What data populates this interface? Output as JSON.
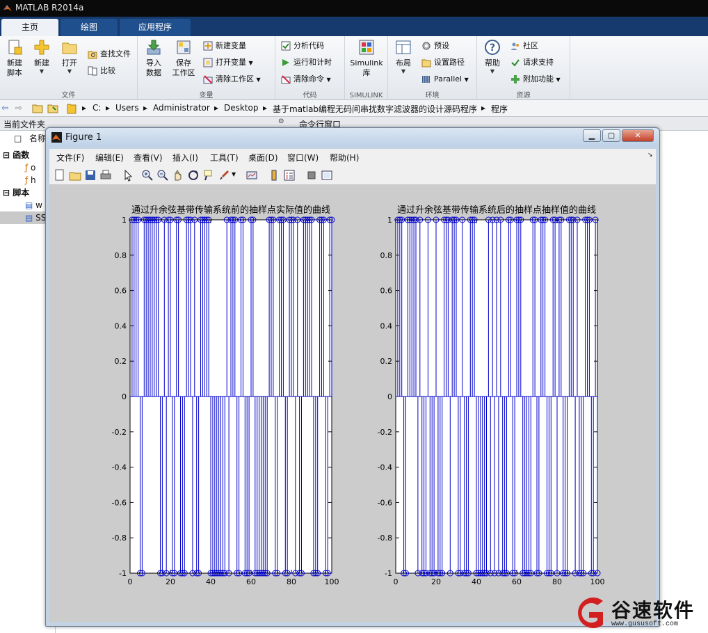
{
  "app": {
    "title": "MATLAB R2014a"
  },
  "tabs": [
    {
      "label": "主页",
      "active": true
    },
    {
      "label": "绘图",
      "active": false
    },
    {
      "label": "应用程序",
      "active": false
    }
  ],
  "ribbon": {
    "file_group": {
      "label": "文件",
      "new_script": "新建\n脚本",
      "new": "新建",
      "open": "打开",
      "find_files": "查找文件",
      "compare": "比较"
    },
    "variable_group": {
      "label": "变量",
      "import_data": "导入\n数据",
      "save_workspace": "保存\n工作区",
      "new_variable": "新建变量",
      "open_variable": "打开变量",
      "clear_workspace": "清除工作区"
    },
    "code_group": {
      "label": "代码",
      "analyze_code": "分析代码",
      "run_and_time": "运行和计时",
      "clear_commands": "清除命令"
    },
    "simulink_group": {
      "label": "SIMULINK",
      "simulink_library": "Simulink\n库"
    },
    "environment_group": {
      "label": "环境",
      "layout": "布局",
      "preferences": "预设",
      "set_path": "设置路径",
      "parallel": "Parallel"
    },
    "resources_group": {
      "label": "资源",
      "help": "帮助",
      "community": "社区",
      "request_support": "请求支持",
      "add_ons": "附加功能"
    }
  },
  "address_bar": {
    "path": [
      "C:",
      "Users",
      "Administrator",
      "Desktop",
      "基于matlab编程无码间串扰数字滤波器的设计源码程序",
      "程序"
    ]
  },
  "panels": {
    "current_folder": "当前文件夹",
    "command_window": "命令行窗口",
    "name_col": "名称",
    "sections": [
      {
        "label": "函数",
        "items": [
          "o",
          "h"
        ]
      },
      {
        "label": "脚本",
        "items": [
          "w",
          "SS"
        ]
      }
    ]
  },
  "figure": {
    "title": "Figure 1",
    "menu": [
      "文件(F)",
      "编辑(E)",
      "查看(V)",
      "插入(I)",
      "工具(T)",
      "桌面(D)",
      "窗口(W)",
      "帮助(H)"
    ]
  },
  "chart_data": [
    {
      "type": "stem",
      "title": "通过升余弦基带传输系统前的抽样点实际值的曲线",
      "xlim": [
        0,
        100
      ],
      "ylim": [
        -1,
        1
      ],
      "xticks": [
        "0",
        "20",
        "40",
        "60",
        "80",
        "100"
      ],
      "yticks": [
        "-1",
        "-0.8",
        "-0.6",
        "-0.4",
        "-0.2",
        "0",
        "0.2",
        "0.4",
        "0.6",
        "0.8",
        "1"
      ],
      "color": "#0000cc",
      "x": [
        1,
        2,
        3,
        4,
        5,
        6,
        7,
        8,
        9,
        10,
        11,
        12,
        13,
        14,
        15,
        16,
        17,
        18,
        19,
        20,
        21,
        22,
        23,
        24,
        25,
        26,
        27,
        28,
        29,
        30,
        31,
        32,
        33,
        34,
        35,
        36,
        37,
        38,
        39,
        40,
        41,
        42,
        43,
        44,
        45,
        46,
        47,
        48,
        49,
        50,
        51,
        52,
        53,
        54,
        55,
        56,
        57,
        58,
        59,
        60,
        61,
        62,
        63,
        64,
        65,
        66,
        67,
        68,
        69,
        70,
        71,
        72,
        73,
        74,
        75,
        76,
        77,
        78,
        79,
        80,
        81,
        82,
        83,
        84,
        85,
        86,
        87,
        88,
        89,
        90,
        91,
        92,
        93,
        94,
        95,
        96,
        97,
        98,
        99,
        100
      ],
      "values": [
        1,
        1,
        1,
        1,
        -1,
        -1,
        1,
        1,
        1,
        1,
        1,
        1,
        1,
        1,
        -1,
        -1,
        1,
        -1,
        1,
        1,
        -1,
        -1,
        1,
        1,
        -1,
        -1,
        -1,
        1,
        1,
        1,
        -1,
        1,
        -1,
        -1,
        1,
        1,
        1,
        1,
        1,
        -1,
        -1,
        -1,
        -1,
        -1,
        -1,
        -1,
        -1,
        1,
        -1,
        1,
        1,
        1,
        -1,
        -1,
        1,
        1,
        -1,
        -1,
        -1,
        1,
        1,
        -1,
        -1,
        -1,
        -1,
        -1,
        -1,
        -1,
        1,
        1,
        1,
        -1,
        -1,
        1,
        1,
        1,
        -1,
        -1,
        1,
        1,
        1,
        -1,
        1,
        -1,
        -1,
        1,
        1,
        1,
        1,
        1,
        -1,
        -1,
        -1,
        1,
        1,
        1,
        -1,
        -1,
        1,
        1
      ]
    },
    {
      "type": "stem",
      "title": "通过升余弦基带传输系统后的抽样点抽样值的曲线",
      "xlim": [
        0,
        100
      ],
      "ylim": [
        -1,
        1
      ],
      "xticks": [
        "0",
        "20",
        "40",
        "60",
        "80",
        "100"
      ],
      "yticks": [
        "-1",
        "-0.8",
        "-0.6",
        "-0.4",
        "-0.2",
        "0",
        "0.2",
        "0.4",
        "0.6",
        "0.8",
        "1"
      ],
      "color": "#0000cc",
      "x": [
        1,
        2,
        3,
        4,
        5,
        6,
        7,
        8,
        9,
        10,
        11,
        12,
        13,
        14,
        15,
        16,
        17,
        18,
        19,
        20,
        21,
        22,
        23,
        24,
        25,
        26,
        27,
        28,
        29,
        30,
        31,
        32,
        33,
        34,
        35,
        36,
        37,
        38,
        39,
        40,
        41,
        42,
        43,
        44,
        45,
        46,
        47,
        48,
        49,
        50,
        51,
        52,
        53,
        54,
        55,
        56,
        57,
        58,
        59,
        60,
        61,
        62,
        63,
        64,
        65,
        66,
        67,
        68,
        69,
        70,
        71,
        72,
        73,
        74,
        75,
        76,
        77,
        78,
        79,
        80,
        81,
        82,
        83,
        84,
        85,
        86,
        87,
        88,
        89,
        90,
        91,
        92,
        93,
        94,
        95,
        96,
        97,
        98,
        99,
        100
      ],
      "values": [
        1,
        1,
        1,
        -1,
        -1,
        1,
        1,
        1,
        1,
        1,
        -1,
        1,
        -1,
        -1,
        -1,
        1,
        -1,
        -1,
        -1,
        1,
        -1,
        -1,
        -1,
        1,
        1,
        1,
        -1,
        1,
        1,
        1,
        -1,
        -1,
        1,
        -1,
        -1,
        -1,
        1,
        1,
        1,
        -1,
        -1,
        -1,
        -1,
        -1,
        -1,
        1,
        -1,
        1,
        -1,
        1,
        -1,
        1,
        -1,
        -1,
        -1,
        1,
        1,
        -1,
        -1,
        1,
        1,
        1,
        -1,
        -1,
        -1,
        -1,
        -1,
        1,
        1,
        -1,
        -1,
        1,
        1,
        1,
        -1,
        -1,
        -1,
        1,
        1,
        -1,
        1,
        1,
        -1,
        -1,
        -1,
        1,
        1,
        1,
        -1,
        1,
        -1,
        -1,
        -1,
        1,
        1,
        1,
        -1,
        -1,
        1,
        -1
      ]
    }
  ],
  "watermark": {
    "text": "谷速软件",
    "url": "www.gususoft.com",
    "color": "#d21f1f"
  }
}
